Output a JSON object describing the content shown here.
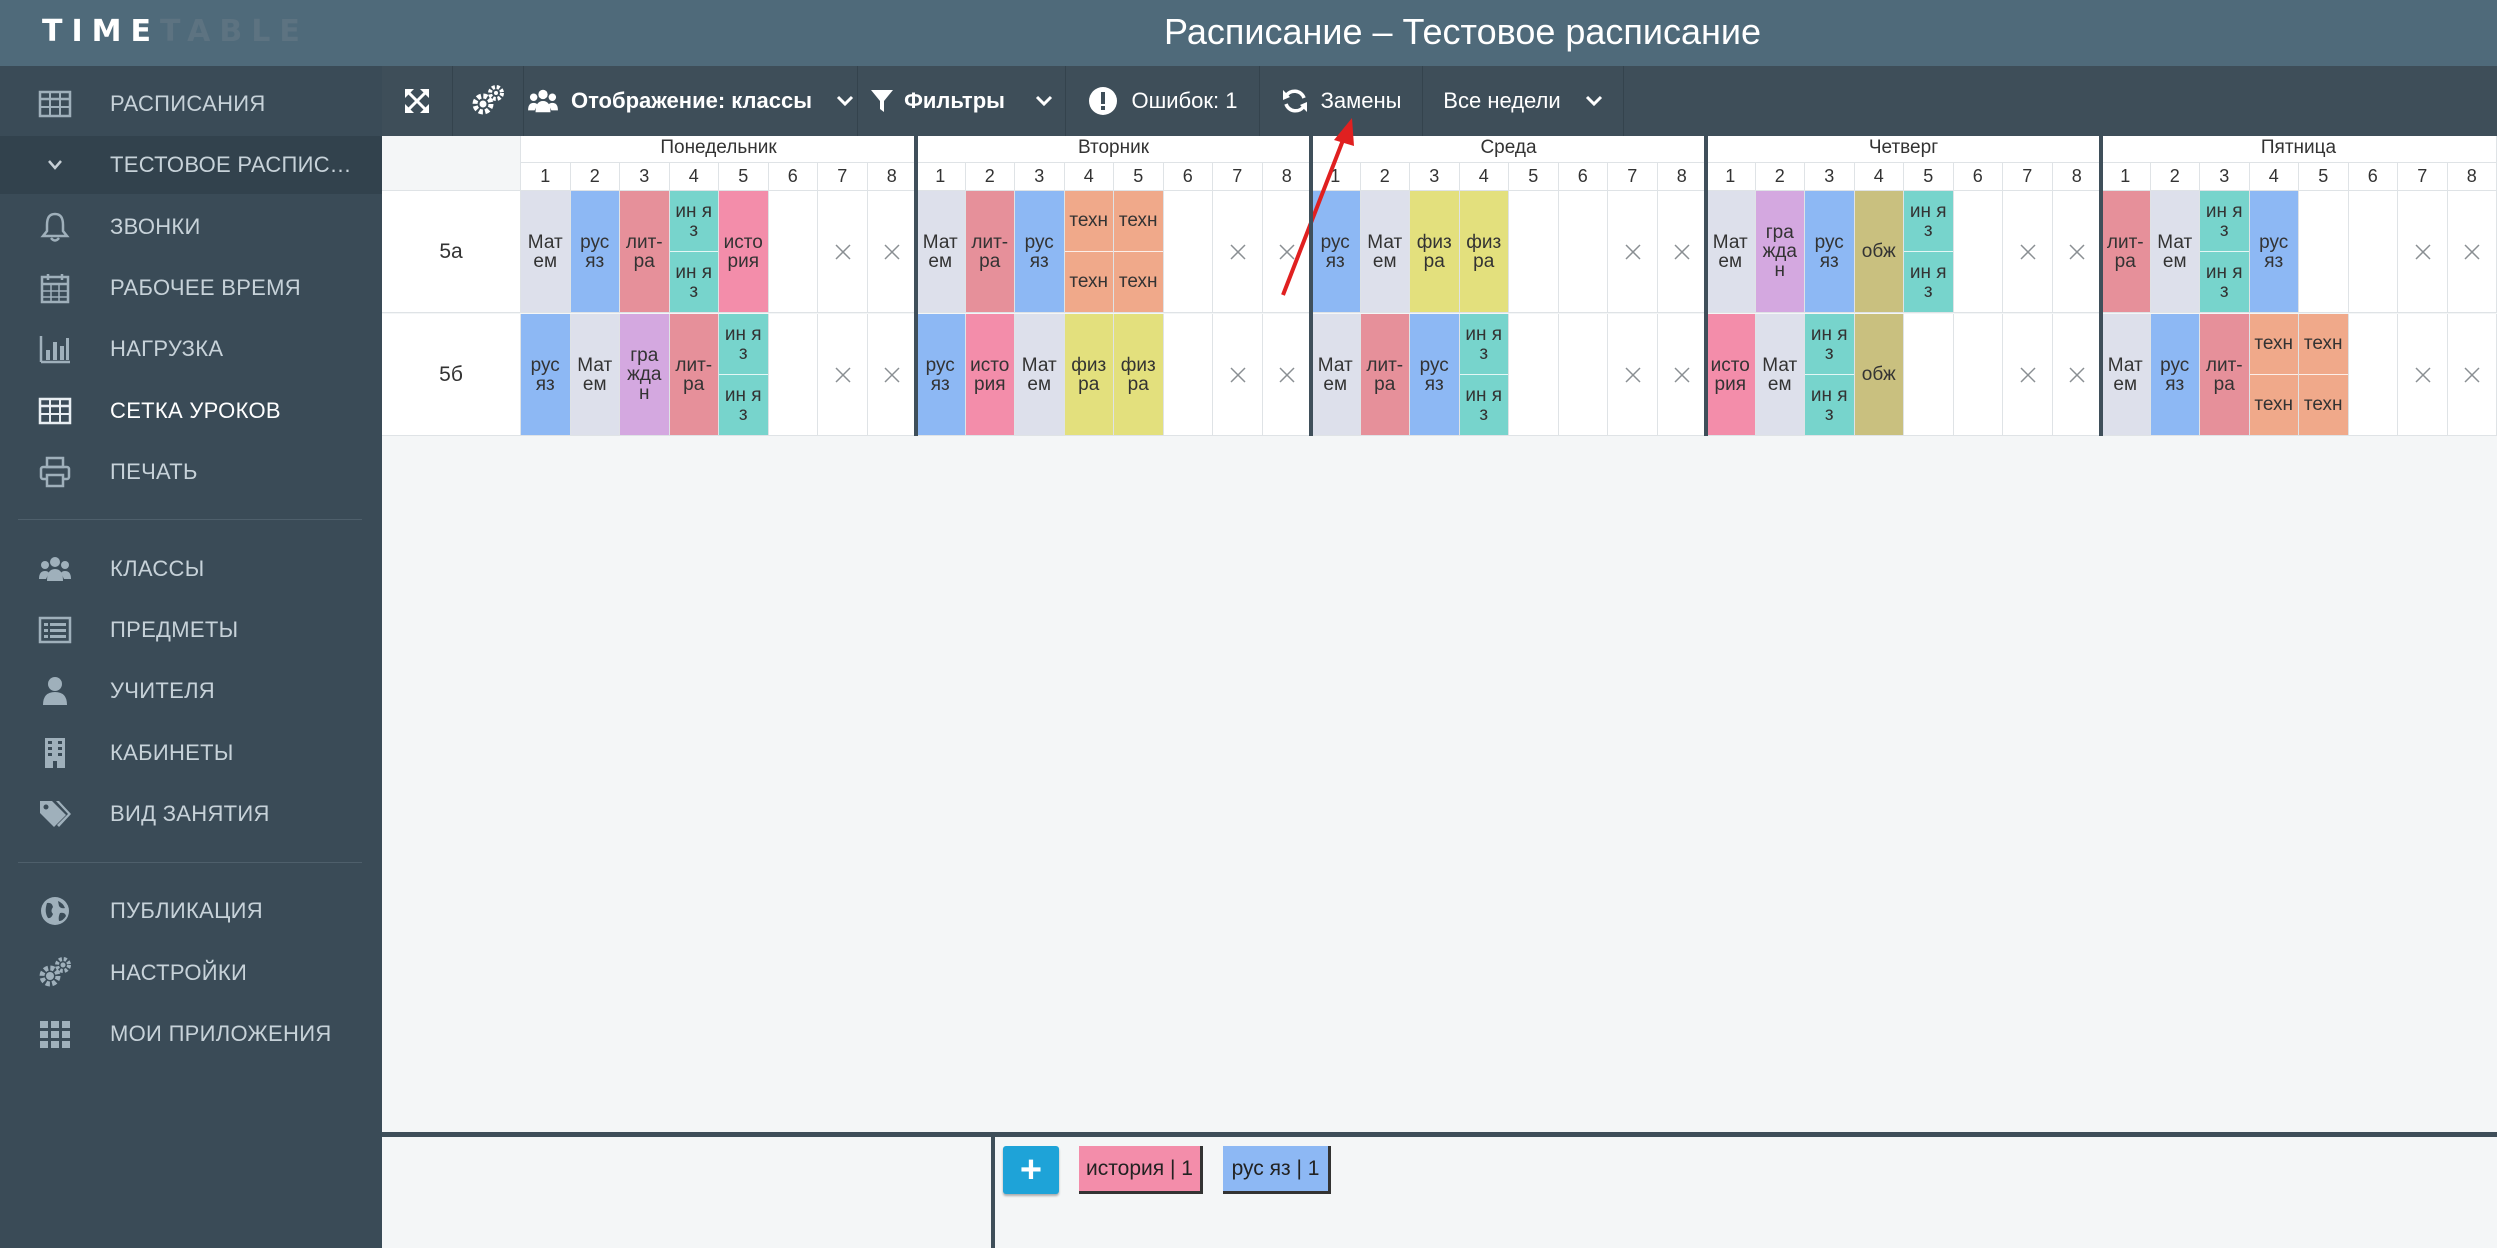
{
  "app": {
    "logo_part1": "TIME",
    "logo_part2": "TABLE",
    "page_title": "Расписание – Тестовое расписание"
  },
  "sidebar": {
    "items": [
      {
        "label": "РАСПИСАНИЯ",
        "icon": "table-icon"
      },
      {
        "label": "ТЕСТОВОЕ РАСПИСАНИЕ",
        "icon": "chevron-down-icon"
      },
      {
        "label": "ЗВОНКИ",
        "icon": "bell-icon"
      },
      {
        "label": "РАБОЧЕЕ ВРЕМЯ",
        "icon": "calendar-icon"
      },
      {
        "label": "НАГРУЗКА",
        "icon": "bar-chart-icon"
      },
      {
        "label": "СЕТКА УРОКОВ",
        "icon": "grid-icon"
      },
      {
        "label": "ПЕЧАТЬ",
        "icon": "printer-icon"
      },
      {
        "label": "КЛАССЫ",
        "icon": "users-icon"
      },
      {
        "label": "ПРЕДМЕТЫ",
        "icon": "list-icon"
      },
      {
        "label": "УЧИТЕЛЯ",
        "icon": "user-icon"
      },
      {
        "label": "КАБИНЕТЫ",
        "icon": "building-icon"
      },
      {
        "label": "ВИД ЗАНЯТИЯ",
        "icon": "tags-icon"
      },
      {
        "label": "ПУБЛИКАЦИЯ",
        "icon": "globe-icon"
      },
      {
        "label": "НАСТРОЙКИ",
        "icon": "gears-icon"
      },
      {
        "label": "МОИ ПРИЛОЖЕНИЯ",
        "icon": "apps-icon"
      }
    ]
  },
  "toolbar": {
    "display_label": "Отображение: классы",
    "filters_label": "Фильтры",
    "errors_label": "Ошибок: 1",
    "replacements_label": "Замены",
    "weeks_label": "Все недели"
  },
  "schedule": {
    "days": [
      "Понедельник",
      "Вторник",
      "Среда",
      "Четверг",
      "Пятница"
    ],
    "periods": [
      "1",
      "2",
      "3",
      "4",
      "5",
      "6",
      "7",
      "8"
    ],
    "rows": [
      {
        "name": "5а",
        "days": [
          [
            {
              "t": "Мат ем",
              "c": "#dde0eb"
            },
            {
              "t": "рус яз",
              "c": "#8db8f4"
            },
            {
              "t": "лит-ра",
              "c": "#e6909a"
            },
            {
              "split": [
                {
                  "t": "ин я з",
                  "c": "#77d4cc"
                },
                {
                  "t": "ин я з",
                  "c": "#77d4cc"
                }
              ]
            },
            {
              "t": "исто рия",
              "c": "#f38daa"
            },
            null,
            "x",
            "x"
          ],
          [
            {
              "t": "Мат ем",
              "c": "#dde0eb"
            },
            {
              "t": "лит-ра",
              "c": "#e6909a"
            },
            {
              "t": "рус яз",
              "c": "#8db8f4"
            },
            {
              "split": [
                {
                  "t": "техн",
                  "c": "#f0a98a"
                },
                {
                  "t": "техн",
                  "c": "#f0a98a"
                }
              ]
            },
            {
              "split": [
                {
                  "t": "техн",
                  "c": "#f0a98a"
                },
                {
                  "t": "техн",
                  "c": "#f0a98a"
                }
              ]
            },
            null,
            "x",
            "x"
          ],
          [
            {
              "t": "рус яз",
              "c": "#8db8f4"
            },
            {
              "t": "Мат ем",
              "c": "#dde0eb"
            },
            {
              "t": "физ ра",
              "c": "#e3e07d"
            },
            {
              "t": "физ ра",
              "c": "#e3e07d"
            },
            null,
            null,
            "x",
            "x"
          ],
          [
            {
              "t": "Мат ем",
              "c": "#dde0eb"
            },
            {
              "t": "гра жда н",
              "c": "#d4a8e0"
            },
            {
              "t": "рус яз",
              "c": "#8db8f4"
            },
            {
              "t": "обж",
              "c": "#c9c07f"
            },
            {
              "split": [
                {
                  "t": "ин я з",
                  "c": "#77d4cc"
                },
                {
                  "t": "ин я з",
                  "c": "#77d4cc"
                }
              ]
            },
            null,
            "x",
            "x"
          ],
          [
            {
              "t": "лит-ра",
              "c": "#e6909a"
            },
            {
              "t": "Мат ем",
              "c": "#dde0eb"
            },
            {
              "split": [
                {
                  "t": "ин я з",
                  "c": "#77d4cc"
                },
                {
                  "t": "ин я з",
                  "c": "#77d4cc"
                }
              ]
            },
            {
              "t": "рус яз",
              "c": "#8db8f4"
            },
            null,
            null,
            "x",
            "x"
          ]
        ]
      },
      {
        "name": "5б",
        "days": [
          [
            {
              "t": "рус яз",
              "c": "#8db8f4"
            },
            {
              "t": "Мат ем",
              "c": "#dde0eb"
            },
            {
              "t": "гра жда н",
              "c": "#d4a8e0"
            },
            {
              "t": "лит-ра",
              "c": "#e6909a"
            },
            {
              "split": [
                {
                  "t": "ин я з",
                  "c": "#77d4cc"
                },
                {
                  "t": "ин я з",
                  "c": "#77d4cc"
                }
              ]
            },
            null,
            "x",
            "x"
          ],
          [
            {
              "t": "рус яз",
              "c": "#8db8f4"
            },
            {
              "t": "исто рия",
              "c": "#f38daa"
            },
            {
              "t": "Мат ем",
              "c": "#dde0eb"
            },
            {
              "t": "физ ра",
              "c": "#e3e07d"
            },
            {
              "t": "физ ра",
              "c": "#e3e07d"
            },
            null,
            "x",
            "x"
          ],
          [
            {
              "t": "Мат ем",
              "c": "#dde0eb"
            },
            {
              "t": "лит-ра",
              "c": "#e6909a"
            },
            {
              "t": "рус яз",
              "c": "#8db8f4"
            },
            {
              "split": [
                {
                  "t": "ин я з",
                  "c": "#77d4cc"
                },
                {
                  "t": "ин я з",
                  "c": "#77d4cc"
                }
              ]
            },
            null,
            null,
            "x",
            "x"
          ],
          [
            {
              "t": "исто рия",
              "c": "#f38daa"
            },
            {
              "t": "Мат ем",
              "c": "#dde0eb"
            },
            {
              "split": [
                {
                  "t": "ин я з",
                  "c": "#77d4cc"
                },
                {
                  "t": "ин я з",
                  "c": "#77d4cc"
                }
              ]
            },
            {
              "t": "обж",
              "c": "#c9c07f"
            },
            null,
            null,
            "x",
            "x"
          ],
          [
            {
              "t": "Мат ем",
              "c": "#dde0eb"
            },
            {
              "t": "рус яз",
              "c": "#8db8f4"
            },
            {
              "t": "лит-ра",
              "c": "#e6909a"
            },
            {
              "split": [
                {
                  "t": "техн",
                  "c": "#f0a98a"
                },
                {
                  "t": "техн",
                  "c": "#f0a98a"
                }
              ]
            },
            {
              "split": [
                {
                  "t": "техн",
                  "c": "#f0a98a"
                },
                {
                  "t": "техн",
                  "c": "#f0a98a"
                }
              ]
            },
            null,
            "x",
            "x"
          ]
        ]
      }
    ]
  },
  "bottom": {
    "add_label": "+",
    "chips": [
      {
        "label": "история | 1",
        "color": "#f38daa"
      },
      {
        "label": "рус яз | 1",
        "color": "#8db8f4"
      }
    ]
  },
  "colors": {
    "header_bg": "#4f6a7a",
    "sidebar_bg": "#3a4b57",
    "toolbar_bg": "#3e4e59",
    "accent_add": "#1ea3d8",
    "annotation_arrow": "#e02020"
  }
}
